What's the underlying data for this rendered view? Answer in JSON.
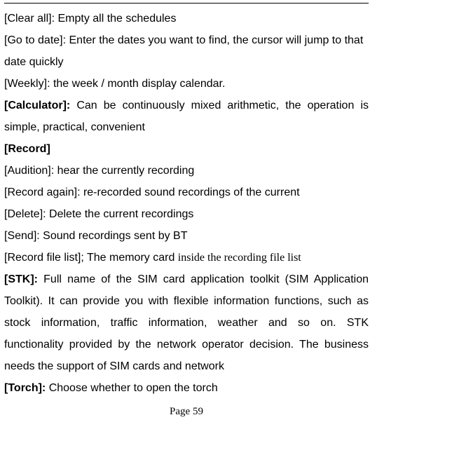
{
  "entries": {
    "clear_all": {
      "label": "[Clear all]",
      "desc": ": Empty all the schedules"
    },
    "go_to_date": {
      "label": "[Go to date]",
      "desc": ": Enter the dates you want to find, the cursor will jump to that date quickly"
    },
    "weekly": {
      "label": "[Weekly]",
      "desc": ": the week / month display calendar."
    },
    "calculator": {
      "label": "[Calculator]:",
      "desc": " Can be continuously mixed arithmetic, the operation is simple, practical, convenient"
    },
    "record": {
      "label": "[Record]"
    },
    "audition": {
      "label": "[Audition]",
      "desc": ": hear the currently recording"
    },
    "record_again": {
      "label": "[Record again]",
      "desc": ": re-recorded sound recordings of the current"
    },
    "delete": {
      "label": "[Delete]",
      "desc": ": Delete the current recordings"
    },
    "send": {
      "label": "[Send]",
      "desc": ": Sound recordings sent by BT"
    },
    "record_file_list": {
      "label": "[Record file list]",
      "desc1": "; The memory card ",
      "desc2": "inside the recording file list"
    },
    "stk": {
      "label": "[STK]:",
      "desc": " Full name of the SIM card application toolkit (SIM Application Toolkit). It can provide you with flexible information functions, such as stock information, traffic information, weather and so on. STK functionality provided by the network operator decision. The business needs the support of SIM cards and network"
    },
    "torch": {
      "label": "[Torch]:",
      "desc": " Choose whether to open the torch"
    }
  },
  "page_number": "Page 59"
}
